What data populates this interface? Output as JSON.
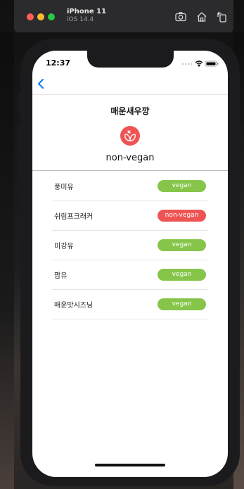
{
  "simulator": {
    "device": "iPhone 11",
    "os": "iOS 14.4"
  },
  "status_bar": {
    "time": "12:37"
  },
  "nav": {
    "back_icon": "chevron-left-icon"
  },
  "product": {
    "name": "매운새우깡",
    "status_icon": "leaf-cross-icon",
    "status": "non-vegan"
  },
  "ingredients": [
    {
      "name": "풍미유",
      "status": "vegan"
    },
    {
      "name": "쉬림프크래커",
      "status": "non-vegan"
    },
    {
      "name": "미강유",
      "status": "vegan"
    },
    {
      "name": "팜유",
      "status": "vegan"
    },
    {
      "name": "매운맛시즈닝",
      "status": "vegan"
    }
  ],
  "colors": {
    "vegan": "#86c54a",
    "non_vegan": "#ef5454",
    "accent": "#007aff"
  }
}
